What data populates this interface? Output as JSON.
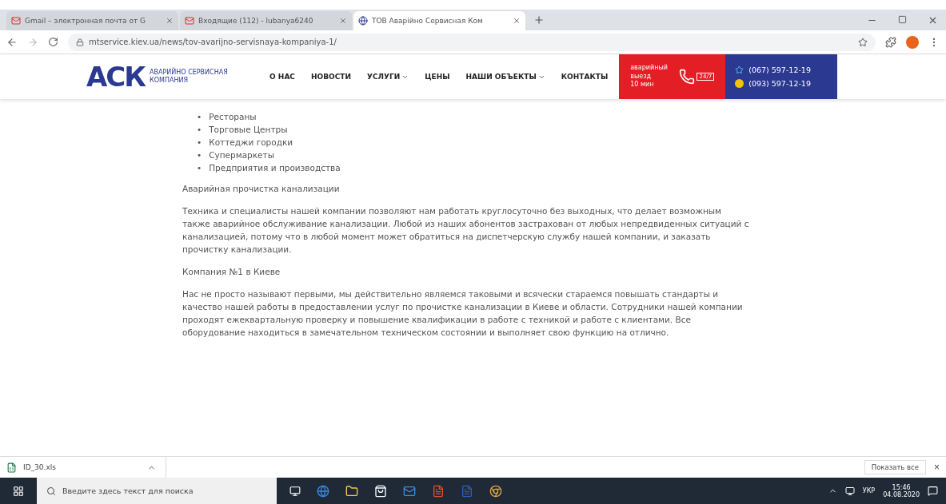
{
  "browser": {
    "tabs": [
      {
        "title": "Gmail – электронная почта от G",
        "selected": false
      },
      {
        "title": "Входящие (112) - lubanya6240",
        "selected": false
      },
      {
        "title": "ТОВ Аварійно Сервисная Ком",
        "selected": true
      }
    ],
    "url": "mtservice.kiev.ua/news/tov-avarijno-servisnaya-kompaniya-1/"
  },
  "site": {
    "logo": "АСК",
    "logo_caption": "АВАРИЙНО СЕРВИСНАЯ КОМПАНИЯ",
    "nav": [
      {
        "label": "О НАС",
        "dropdown": false
      },
      {
        "label": "НОВОСТИ",
        "dropdown": false
      },
      {
        "label": "УСЛУГИ",
        "dropdown": true
      },
      {
        "label": "ЦЕНЫ",
        "dropdown": false
      },
      {
        "label": "НАШИ ОБЪЕКТЫ",
        "dropdown": true
      },
      {
        "label": "КОНТАКТЫ",
        "dropdown": false
      }
    ],
    "emergency": {
      "lines": [
        "аварийный",
        "выезд",
        "10 мин"
      ],
      "badge": "24/7"
    },
    "phones": [
      "(067) 597-12-19",
      "(093) 597-12-19"
    ]
  },
  "content": {
    "list": [
      {
        "bullet": "•",
        "text": "Рестораны"
      },
      {
        "bullet": "•",
        "text": "Торговые Центры"
      },
      {
        "bullet": "•",
        "text": "Коттеджи городки"
      },
      {
        "bullet": "•",
        "text": "Супермаркеты"
      },
      {
        "bullet": "•",
        "text": "Предприятия и производства"
      }
    ],
    "blocks": [
      {
        "kind": "heading",
        "text": "Аварийная прочистка канализации"
      },
      {
        "kind": "paragraph",
        "text": "Техника и специалисты нашей компании позволяют нам работать круглосуточно без выходных, что делает возможным также аварийное обслуживание канализации. Любой из наших абонентов застрахован от любых непредвиденных ситуаций с канализацией, потому что в любой момент может обратиться на диспетчерскую службу нашей компании, и заказать прочистку канализации."
      },
      {
        "kind": "heading",
        "text": "Компания №1 в Киеве"
      },
      {
        "kind": "paragraph",
        "text": "Нас не просто называют первыми, мы действительно являемся таковыми и всячески стараемся повышать стандарты и качество нашей работы в предоставлении услуг по прочистке канализации в Киеве и области. Сотрудники нашей компании проходят ежеквартальную проверку и повышение квалификации в работе с техникой и работе с клиентами. Все оборудование находиться в замечательном техническом состоянии и выполняет свою функцию на отлично."
      }
    ]
  },
  "downloads": {
    "file": "ID_30.xls",
    "show_all": "Показать все",
    "close": "×"
  },
  "taskbar": {
    "search_placeholder": "Введите здесь текст для поиска",
    "language": "УКР",
    "time": "15:46",
    "date": "04.08.2020"
  }
}
